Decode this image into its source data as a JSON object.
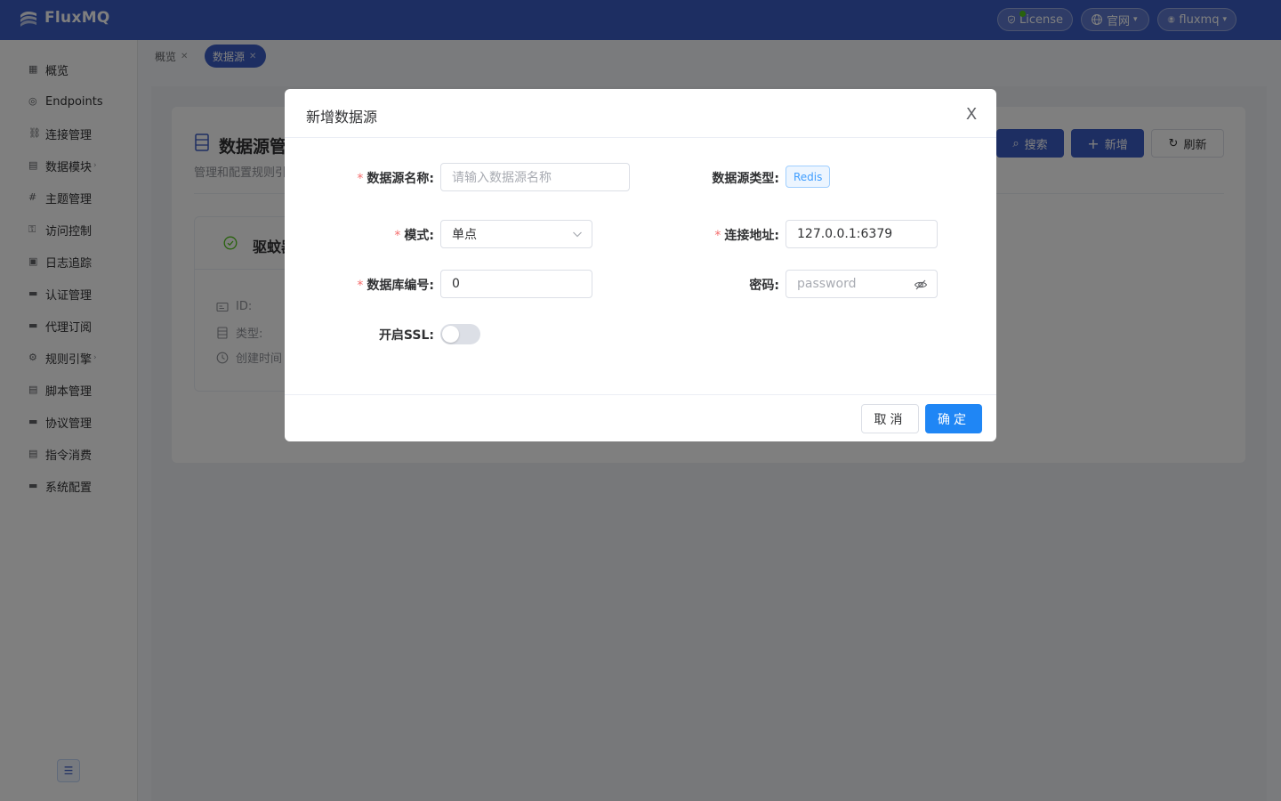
{
  "header": {
    "logo_text": "FluxMQ",
    "license_label": "License",
    "site_label": "官网",
    "user_label": "fluxmq"
  },
  "sidebar": {
    "items": [
      {
        "label": "概览",
        "icon": "dashboard-icon"
      },
      {
        "label": "Endpoints",
        "icon": "globe-icon"
      },
      {
        "label": "连接管理",
        "icon": "connection-icon"
      },
      {
        "label": "数据模块",
        "icon": "data-module-icon",
        "has_children": true
      },
      {
        "label": "主题管理",
        "icon": "topic-icon"
      },
      {
        "label": "访问控制",
        "icon": "access-control-icon"
      },
      {
        "label": "日志追踪",
        "icon": "log-icon"
      },
      {
        "label": "认证管理",
        "icon": "auth-icon"
      },
      {
        "label": "代理订阅",
        "icon": "subscription-icon"
      },
      {
        "label": "规则引擎",
        "icon": "rule-engine-icon",
        "has_children": true
      },
      {
        "label": "脚本管理",
        "icon": "script-icon"
      },
      {
        "label": "协议管理",
        "icon": "protocol-icon"
      },
      {
        "label": "指令消费",
        "icon": "command-icon"
      },
      {
        "label": "系统配置",
        "icon": "settings-icon"
      }
    ],
    "collapse_icon": "collapse-icon"
  },
  "tabs": [
    {
      "label": "概览",
      "active": false
    },
    {
      "label": "数据源",
      "active": true
    }
  ],
  "main": {
    "title": "数据源管",
    "subtitle": "管理和配置规则引",
    "search_label": "搜索",
    "add_label": "新增",
    "refresh_label": "刷新",
    "item": {
      "name": "驱蚊器",
      "id_label": "ID:",
      "type_label": "类型:",
      "created_label": "创建时间"
    }
  },
  "modal": {
    "title": "新增数据源",
    "close_label": "X",
    "fields": {
      "name": {
        "label": "数据源名称:",
        "placeholder": "请输入数据源名称",
        "required": true
      },
      "type": {
        "label": "数据源类型:",
        "value": "Redis"
      },
      "mode": {
        "label": "模式:",
        "value": "单点",
        "required": true
      },
      "address": {
        "label": "连接地址:",
        "value": "127.0.0.1:6379",
        "required": true
      },
      "db_index": {
        "label": "数据库编号:",
        "value": "0",
        "required": true
      },
      "password": {
        "label": "密码:",
        "placeholder": "password"
      },
      "ssl": {
        "label": "开启SSL:",
        "enabled": false
      }
    },
    "cancel_label": "取消",
    "ok_label": "确定"
  },
  "colors": {
    "header_bg": "#3b5cc4",
    "primary_button": "#1f86f5",
    "required_star": "#f56c6c",
    "tag_blue": "#409eff"
  }
}
